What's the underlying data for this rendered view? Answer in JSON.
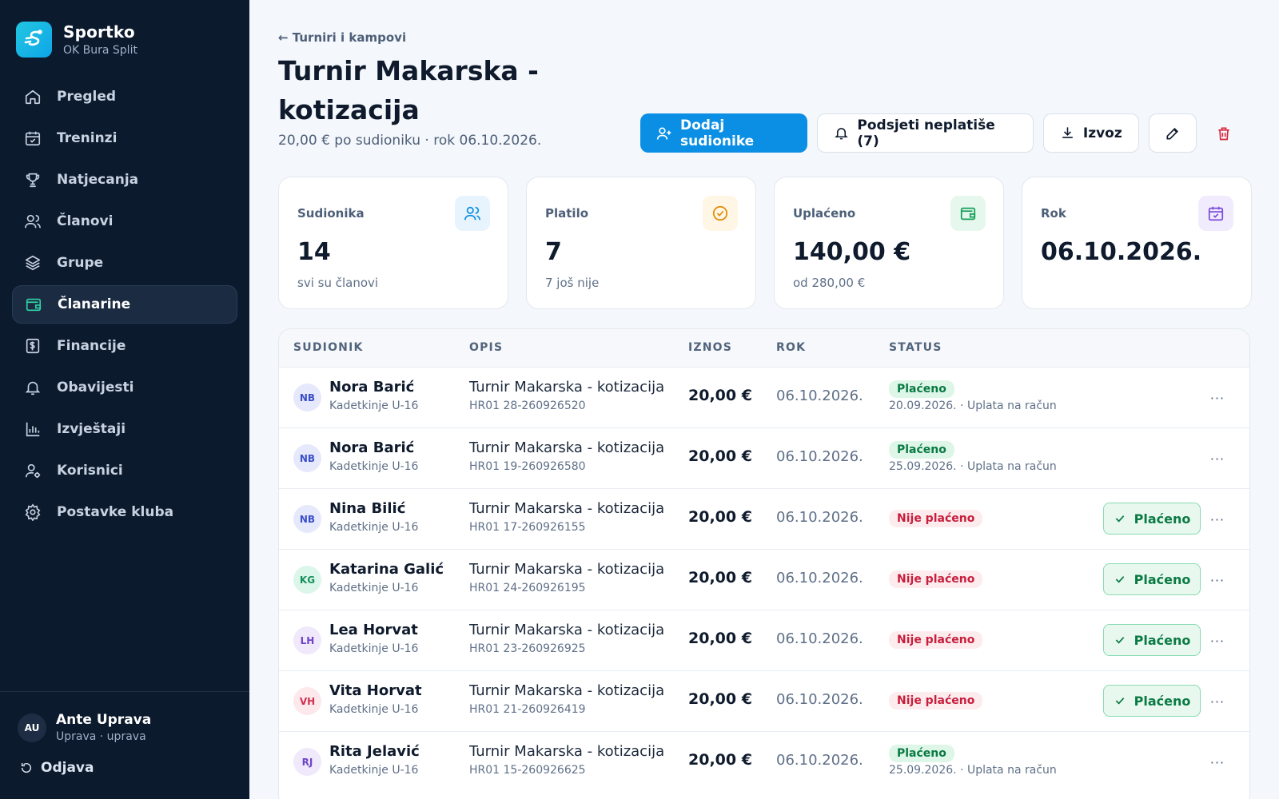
{
  "brand": {
    "name": "Sportko",
    "club": "OK Bura Split"
  },
  "nav": [
    {
      "label": "Pregled",
      "icon": "home-icon"
    },
    {
      "label": "Treninzi",
      "icon": "calendar-check-icon"
    },
    {
      "label": "Natjecanja",
      "icon": "trophy-icon"
    },
    {
      "label": "Članovi",
      "icon": "users-icon"
    },
    {
      "label": "Grupe",
      "icon": "layers-icon"
    },
    {
      "label": "Članarine",
      "icon": "wallet-icon",
      "active": true
    },
    {
      "label": "Financije",
      "icon": "receipt-icon"
    },
    {
      "label": "Obavijesti",
      "icon": "bell-icon"
    },
    {
      "label": "Izvještaji",
      "icon": "bar-chart-icon"
    },
    {
      "label": "Korisnici",
      "icon": "user-cog-icon"
    },
    {
      "label": "Postavke kluba",
      "icon": "gear-icon"
    }
  ],
  "user": {
    "initials": "AU",
    "name": "Ante Uprava",
    "role": "Uprava · uprava"
  },
  "logout_label": "Odjava",
  "header": {
    "back_label": "← Turniri i kampovi",
    "title": "Turnir Makarska - kotizacija",
    "subtitle": "20,00 € po sudioniku · rok 06.10.2026."
  },
  "actions": {
    "add_label": "Dodaj sudionike",
    "remind_label": "Podsjeti neplatiše (7)",
    "export_label": "Izvoz"
  },
  "stats": [
    {
      "label": "Sudionika",
      "value": "14",
      "sub": "svi su članovi",
      "icon": "users-icon",
      "bg": "#e8f4fd",
      "fg": "#0b8fe4"
    },
    {
      "label": "Platilo",
      "value": "7",
      "sub": "7 još nije",
      "icon": "check-circle-icon",
      "bg": "#fff6e5",
      "fg": "#e38b06"
    },
    {
      "label": "Uplaćeno",
      "value": "140,00 €",
      "sub": "od 280,00 €",
      "icon": "wallet-icon",
      "bg": "#e6f7ee",
      "fg": "#16a05a"
    },
    {
      "label": "Rok",
      "value": "06.10.2026.",
      "sub": "",
      "icon": "calendar-icon",
      "bg": "#f1ecfd",
      "fg": "#7c4ddb"
    }
  ],
  "table": {
    "columns": [
      "SUDIONIK",
      "OPIS",
      "IZNOS",
      "ROK",
      "STATUS"
    ],
    "mark_paid_label": "Plaćeno",
    "more_label": "···",
    "rows": [
      {
        "initials": "NB",
        "avatar_bg": "#e6e9fb",
        "avatar_fg": "#3b4fc8",
        "name": "Nora Barić",
        "group": "Kadetkinje U-16",
        "desc": "Turnir Makarska - kotizacija",
        "ref": "HR01 28-260926520",
        "amount": "20,00 €",
        "due": "06.10.2026.",
        "status": "Plaćeno",
        "paid": true,
        "note": "20.09.2026. · Uplata na račun"
      },
      {
        "initials": "NB",
        "avatar_bg": "#e6e9fb",
        "avatar_fg": "#3b4fc8",
        "name": "Nora Barić",
        "group": "Kadetkinje U-16",
        "desc": "Turnir Makarska - kotizacija",
        "ref": "HR01 19-260926580",
        "amount": "20,00 €",
        "due": "06.10.2026.",
        "status": "Plaćeno",
        "paid": true,
        "note": "25.09.2026. · Uplata na račun"
      },
      {
        "initials": "NB",
        "avatar_bg": "#e6e9fb",
        "avatar_fg": "#3b4fc8",
        "name": "Nina Bilić",
        "group": "Kadetkinje U-16",
        "desc": "Turnir Makarska - kotizacija",
        "ref": "HR01 17-260926155",
        "amount": "20,00 €",
        "due": "06.10.2026.",
        "status": "Nije plaćeno",
        "paid": false,
        "note": ""
      },
      {
        "initials": "KG",
        "avatar_bg": "#dcf6ec",
        "avatar_fg": "#16905a",
        "name": "Katarina Galić",
        "group": "Kadetkinje U-16",
        "desc": "Turnir Makarska - kotizacija",
        "ref": "HR01 24-260926195",
        "amount": "20,00 €",
        "due": "06.10.2026.",
        "status": "Nije plaćeno",
        "paid": false,
        "note": ""
      },
      {
        "initials": "LH",
        "avatar_bg": "#efe9fb",
        "avatar_fg": "#7044c8",
        "name": "Lea Horvat",
        "group": "Kadetkinje U-16",
        "desc": "Turnir Makarska - kotizacija",
        "ref": "HR01 23-260926925",
        "amount": "20,00 €",
        "due": "06.10.2026.",
        "status": "Nije plaćeno",
        "paid": false,
        "note": ""
      },
      {
        "initials": "VH",
        "avatar_bg": "#fde8ec",
        "avatar_fg": "#d0304f",
        "name": "Vita Horvat",
        "group": "Kadetkinje U-16",
        "desc": "Turnir Makarska - kotizacija",
        "ref": "HR01 21-260926419",
        "amount": "20,00 €",
        "due": "06.10.2026.",
        "status": "Nije plaćeno",
        "paid": false,
        "note": ""
      },
      {
        "initials": "RJ",
        "avatar_bg": "#efe9fb",
        "avatar_fg": "#7044c8",
        "name": "Rita Jelavić",
        "group": "Kadetkinje U-16",
        "desc": "Turnir Makarska - kotizacija",
        "ref": "HR01 15-260926625",
        "amount": "20,00 €",
        "due": "06.10.2026.",
        "status": "Plaćeno",
        "paid": true,
        "note": "25.09.2026. · Uplata na račun"
      }
    ]
  }
}
